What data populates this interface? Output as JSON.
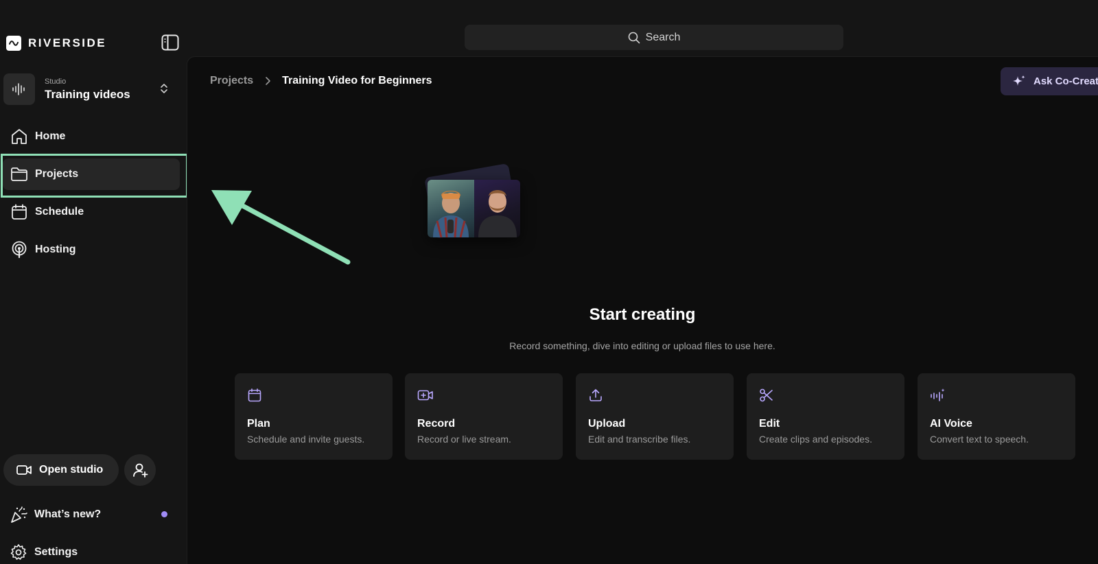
{
  "brand": {
    "name": "RIVERSIDE"
  },
  "studio": {
    "label": "Studio",
    "name": "Training videos"
  },
  "nav": [
    {
      "label": "Home",
      "icon": "home-icon"
    },
    {
      "label": "Projects",
      "icon": "folder-icon",
      "active": true
    },
    {
      "label": "Schedule",
      "icon": "calendar-icon"
    },
    {
      "label": "Hosting",
      "icon": "podcast-icon"
    }
  ],
  "sidebar_bottom": {
    "open_studio": "Open studio",
    "whats_new": "What’s new?",
    "settings": "Settings"
  },
  "search": {
    "placeholder": "Search"
  },
  "breadcrumb": {
    "parent": "Projects",
    "current": "Training Video for Beginners"
  },
  "cocreator": {
    "label": "Ask Co-Creator"
  },
  "empty_state": {
    "title": "Start creating",
    "subtitle": "Record something, dive into editing or upload files to use here."
  },
  "cards": [
    {
      "title": "Plan",
      "desc": "Schedule and invite guests.",
      "icon": "calendar-icon"
    },
    {
      "title": "Record",
      "desc": "Record or live stream.",
      "icon": "video-plus-icon"
    },
    {
      "title": "Upload",
      "desc": "Edit and transcribe files.",
      "icon": "upload-icon"
    },
    {
      "title": "Edit",
      "desc": "Create clips and episodes.",
      "icon": "scissors-icon"
    },
    {
      "title": "AI Voice",
      "desc": "Convert text to speech.",
      "icon": "ai-voice-icon"
    }
  ],
  "colors": {
    "accent": "#a08cf5",
    "highlight": "#8fe0b6",
    "background": "#151515",
    "panel": "#0d0d0d"
  }
}
